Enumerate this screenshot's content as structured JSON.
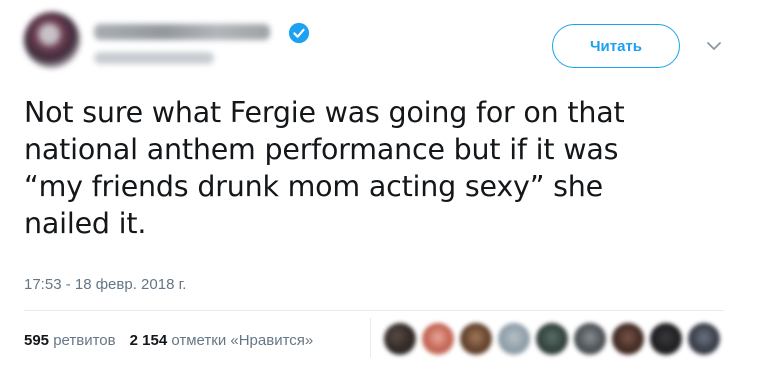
{
  "follow_button": {
    "label": "Читать"
  },
  "tweet": {
    "text": "Not sure what Fergie was going for on that\nnational anthem performance but if it was\n“my friends drunk mom acting sexy” she\nnailed it.",
    "timestamp": "17:53 - 18 февр. 2018 г."
  },
  "stats": {
    "retweets_count": "595",
    "retweets_label": "ретвитов",
    "likes_count": "2 154",
    "likes_label": "отметки «Нравится»"
  },
  "colors": {
    "accent": "#1da1f2",
    "text": "#14171a",
    "muted": "#657786"
  }
}
